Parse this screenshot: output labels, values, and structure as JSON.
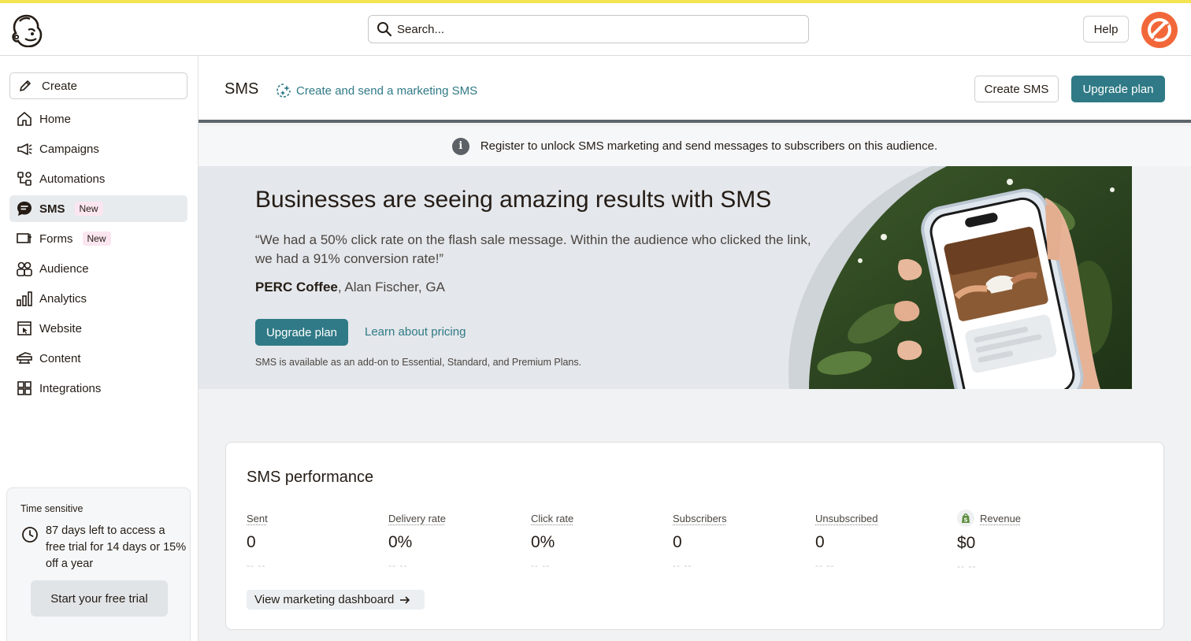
{
  "header": {
    "search_placeholder": "Search...",
    "help_label": "Help"
  },
  "sidebar": {
    "create_label": "Create",
    "items": [
      {
        "label": "Home",
        "icon": "home-icon"
      },
      {
        "label": "Campaigns",
        "icon": "megaphone-icon"
      },
      {
        "label": "Automations",
        "icon": "automations-icon"
      },
      {
        "label": "SMS",
        "icon": "sms-icon",
        "badge": "New",
        "active": true
      },
      {
        "label": "Forms",
        "icon": "forms-icon",
        "badge": "New"
      },
      {
        "label": "Audience",
        "icon": "audience-icon"
      },
      {
        "label": "Analytics",
        "icon": "analytics-icon"
      },
      {
        "label": "Website",
        "icon": "website-icon"
      },
      {
        "label": "Content",
        "icon": "content-icon"
      },
      {
        "label": "Integrations",
        "icon": "integrations-icon"
      }
    ],
    "promo": {
      "title": "Time sensitive",
      "text": "87 days left to access a free trial for 14 days or 15% off a year",
      "button": "Start your free trial"
    }
  },
  "page": {
    "title": "SMS",
    "subtitle_link": "Create and send a marketing SMS",
    "create_sms_label": "Create SMS",
    "upgrade_label": "Upgrade plan"
  },
  "notice": {
    "text": "Register to unlock SMS marketing and send messages to subscribers on this audience."
  },
  "hero": {
    "heading": "Businesses are seeing amazing results with SMS",
    "quote": "“We had a 50% click rate on the flash sale message. Within the audience who clicked the link, we had a 91% conversion rate!”",
    "author_company": "PERC Coffee",
    "author_rest": ", Alan Fischer, GA",
    "upgrade_label": "Upgrade plan",
    "pricing_label": "Learn about pricing",
    "availability": "SMS is available as an add-on to Essential, Standard, and Premium Plans."
  },
  "performance": {
    "title": "SMS performance",
    "metrics": [
      {
        "label": "Sent",
        "value": "0",
        "change": "-- --"
      },
      {
        "label": "Delivery rate",
        "value": "0%",
        "change": "-- --"
      },
      {
        "label": "Click rate",
        "value": "0%",
        "change": "-- --"
      },
      {
        "label": "Subscribers",
        "value": "0",
        "change": "-- --"
      },
      {
        "label": "Unsubscribed",
        "value": "0",
        "change": "-- --"
      },
      {
        "label": "Revenue",
        "value": "$0",
        "change": "-- --"
      }
    ],
    "dashboard_label": "View marketing dashboard"
  },
  "colors": {
    "accent": "#2f7a86",
    "top_strip": "#f5e452",
    "avatar": "#f26739",
    "badge_bg": "#fbe6f0"
  }
}
